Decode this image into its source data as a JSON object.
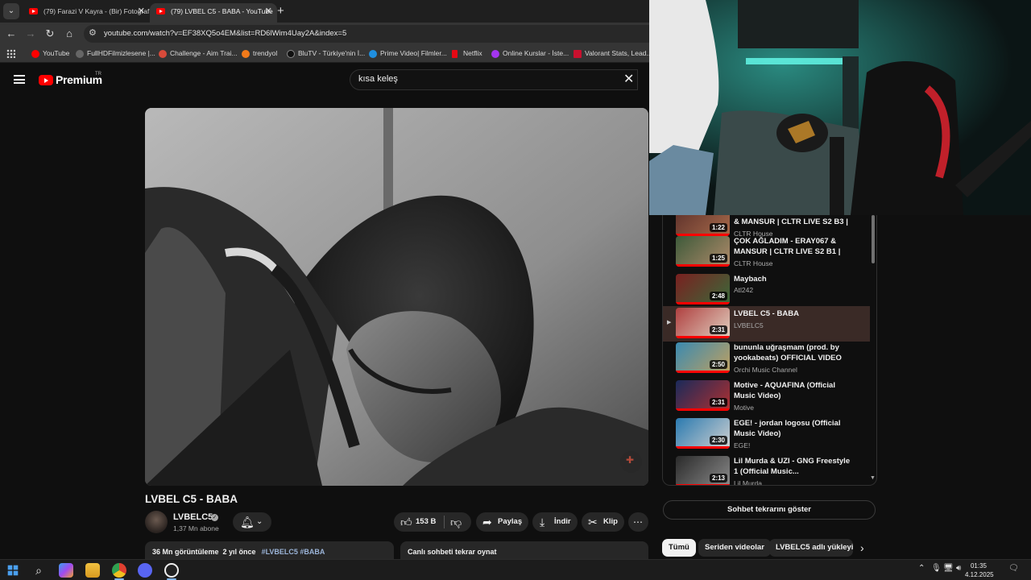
{
  "browser": {
    "tabs": [
      {
        "title": "(79) Farazi V Kayra - (Bir) Fotoğraf",
        "active": false
      },
      {
        "title": "(79) LVBEL C5 - BABA - YouTube",
        "active": true
      }
    ],
    "url": "youtube.com/watch?v=EF38XQ5o4EM&list=RD6lWim4Uay2A&index=5",
    "bookmarks": [
      {
        "label": "YouTube",
        "color": "#ff0000"
      },
      {
        "label": "FullHDFilmizlesene |...",
        "color": "#666666"
      },
      {
        "label": "Challenge - Aim Trai...",
        "color": "#d84a3a"
      },
      {
        "label": "trendyol",
        "color": "#f27a1a"
      },
      {
        "label": "BluTV - Türkiye'nin İ...",
        "color": "#1a1a1a"
      },
      {
        "label": "Prime Video| Filmler...",
        "color": "#1f8fe0"
      },
      {
        "label": "Netflix",
        "color": "#e50914"
      },
      {
        "label": "Online Kurslar - İste...",
        "color": "#a435f0"
      },
      {
        "label": "Valorant Stats, Lead...",
        "color": "#c8102e"
      }
    ]
  },
  "youtube": {
    "logo_text": "Premium",
    "country": "TR",
    "search_value": "kısa keleş",
    "video": {
      "title": "LVBEL C5 - BABA",
      "channel": "LVBELC5",
      "subscribers": "1,37 Mn abone",
      "likes": "153 B",
      "share_label": "Paylaş",
      "download_label": "İndir",
      "clip_label": "Klip",
      "views": "36 Mn görüntüleme",
      "age": "2 yıl önce",
      "tags": "#LVBELC5 #BABA",
      "chat_replay_label": "Canlı sohbeti tekrar oynat"
    },
    "playlist": [
      {
        "title": "& MANSUR | CLTR LIVE S2 B3 |",
        "channel": "CLTR House",
        "duration": "1:22",
        "colors": [
          "#5a2f2a",
          "#a86a4a"
        ]
      },
      {
        "title": "ÇOK AĞLADIM - ERAY067 & MANSUR | CLTR LIVE S2 B1 |",
        "channel": "CLTR House",
        "duration": "1:25",
        "colors": [
          "#3d5a3a",
          "#b08a6a"
        ]
      },
      {
        "title": "Maybach",
        "channel": "Atl242",
        "duration": "2:48",
        "colors": [
          "#7a2020",
          "#3a6a3a"
        ]
      },
      {
        "title": "LVBEL C5 - BABA",
        "channel": "LVBELC5",
        "duration": "2:31",
        "colors": [
          "#b04040",
          "#e0d0c0"
        ],
        "current": true
      },
      {
        "title": "bununla uğraşmam (prod. by yookabeats) OFFICIAL VIDEO",
        "channel": "Orchi Music Channel",
        "duration": "2:50",
        "colors": [
          "#3a8ab0",
          "#c0a060"
        ]
      },
      {
        "title": "Motive - AQUAFINA (Official Music Video)",
        "channel": "Motive",
        "duration": "2:31",
        "colors": [
          "#1a2a5a",
          "#b03030"
        ]
      },
      {
        "title": "EGE! - jordan logosu (Official Music Video)",
        "channel": "EGE!",
        "duration": "2:30",
        "colors": [
          "#2a7ab0",
          "#d0d0d0"
        ]
      },
      {
        "title": "Lil Murda & UZI - GNG Freestyle 1 (Official Music...",
        "channel": "Lil Murda",
        "duration": "2:13",
        "colors": [
          "#2a2a2a",
          "#8a8a8a"
        ]
      }
    ],
    "chat_replay_button": "Sohbet tekrarını göster",
    "chips": [
      {
        "label": "Tümü",
        "active": true
      },
      {
        "label": "Seriden videolar",
        "active": false
      },
      {
        "label": "LVBELC5 adlı yükleyici",
        "active": false
      }
    ]
  },
  "taskbar": {
    "time": "01:35",
    "date": "4.12.2025"
  }
}
